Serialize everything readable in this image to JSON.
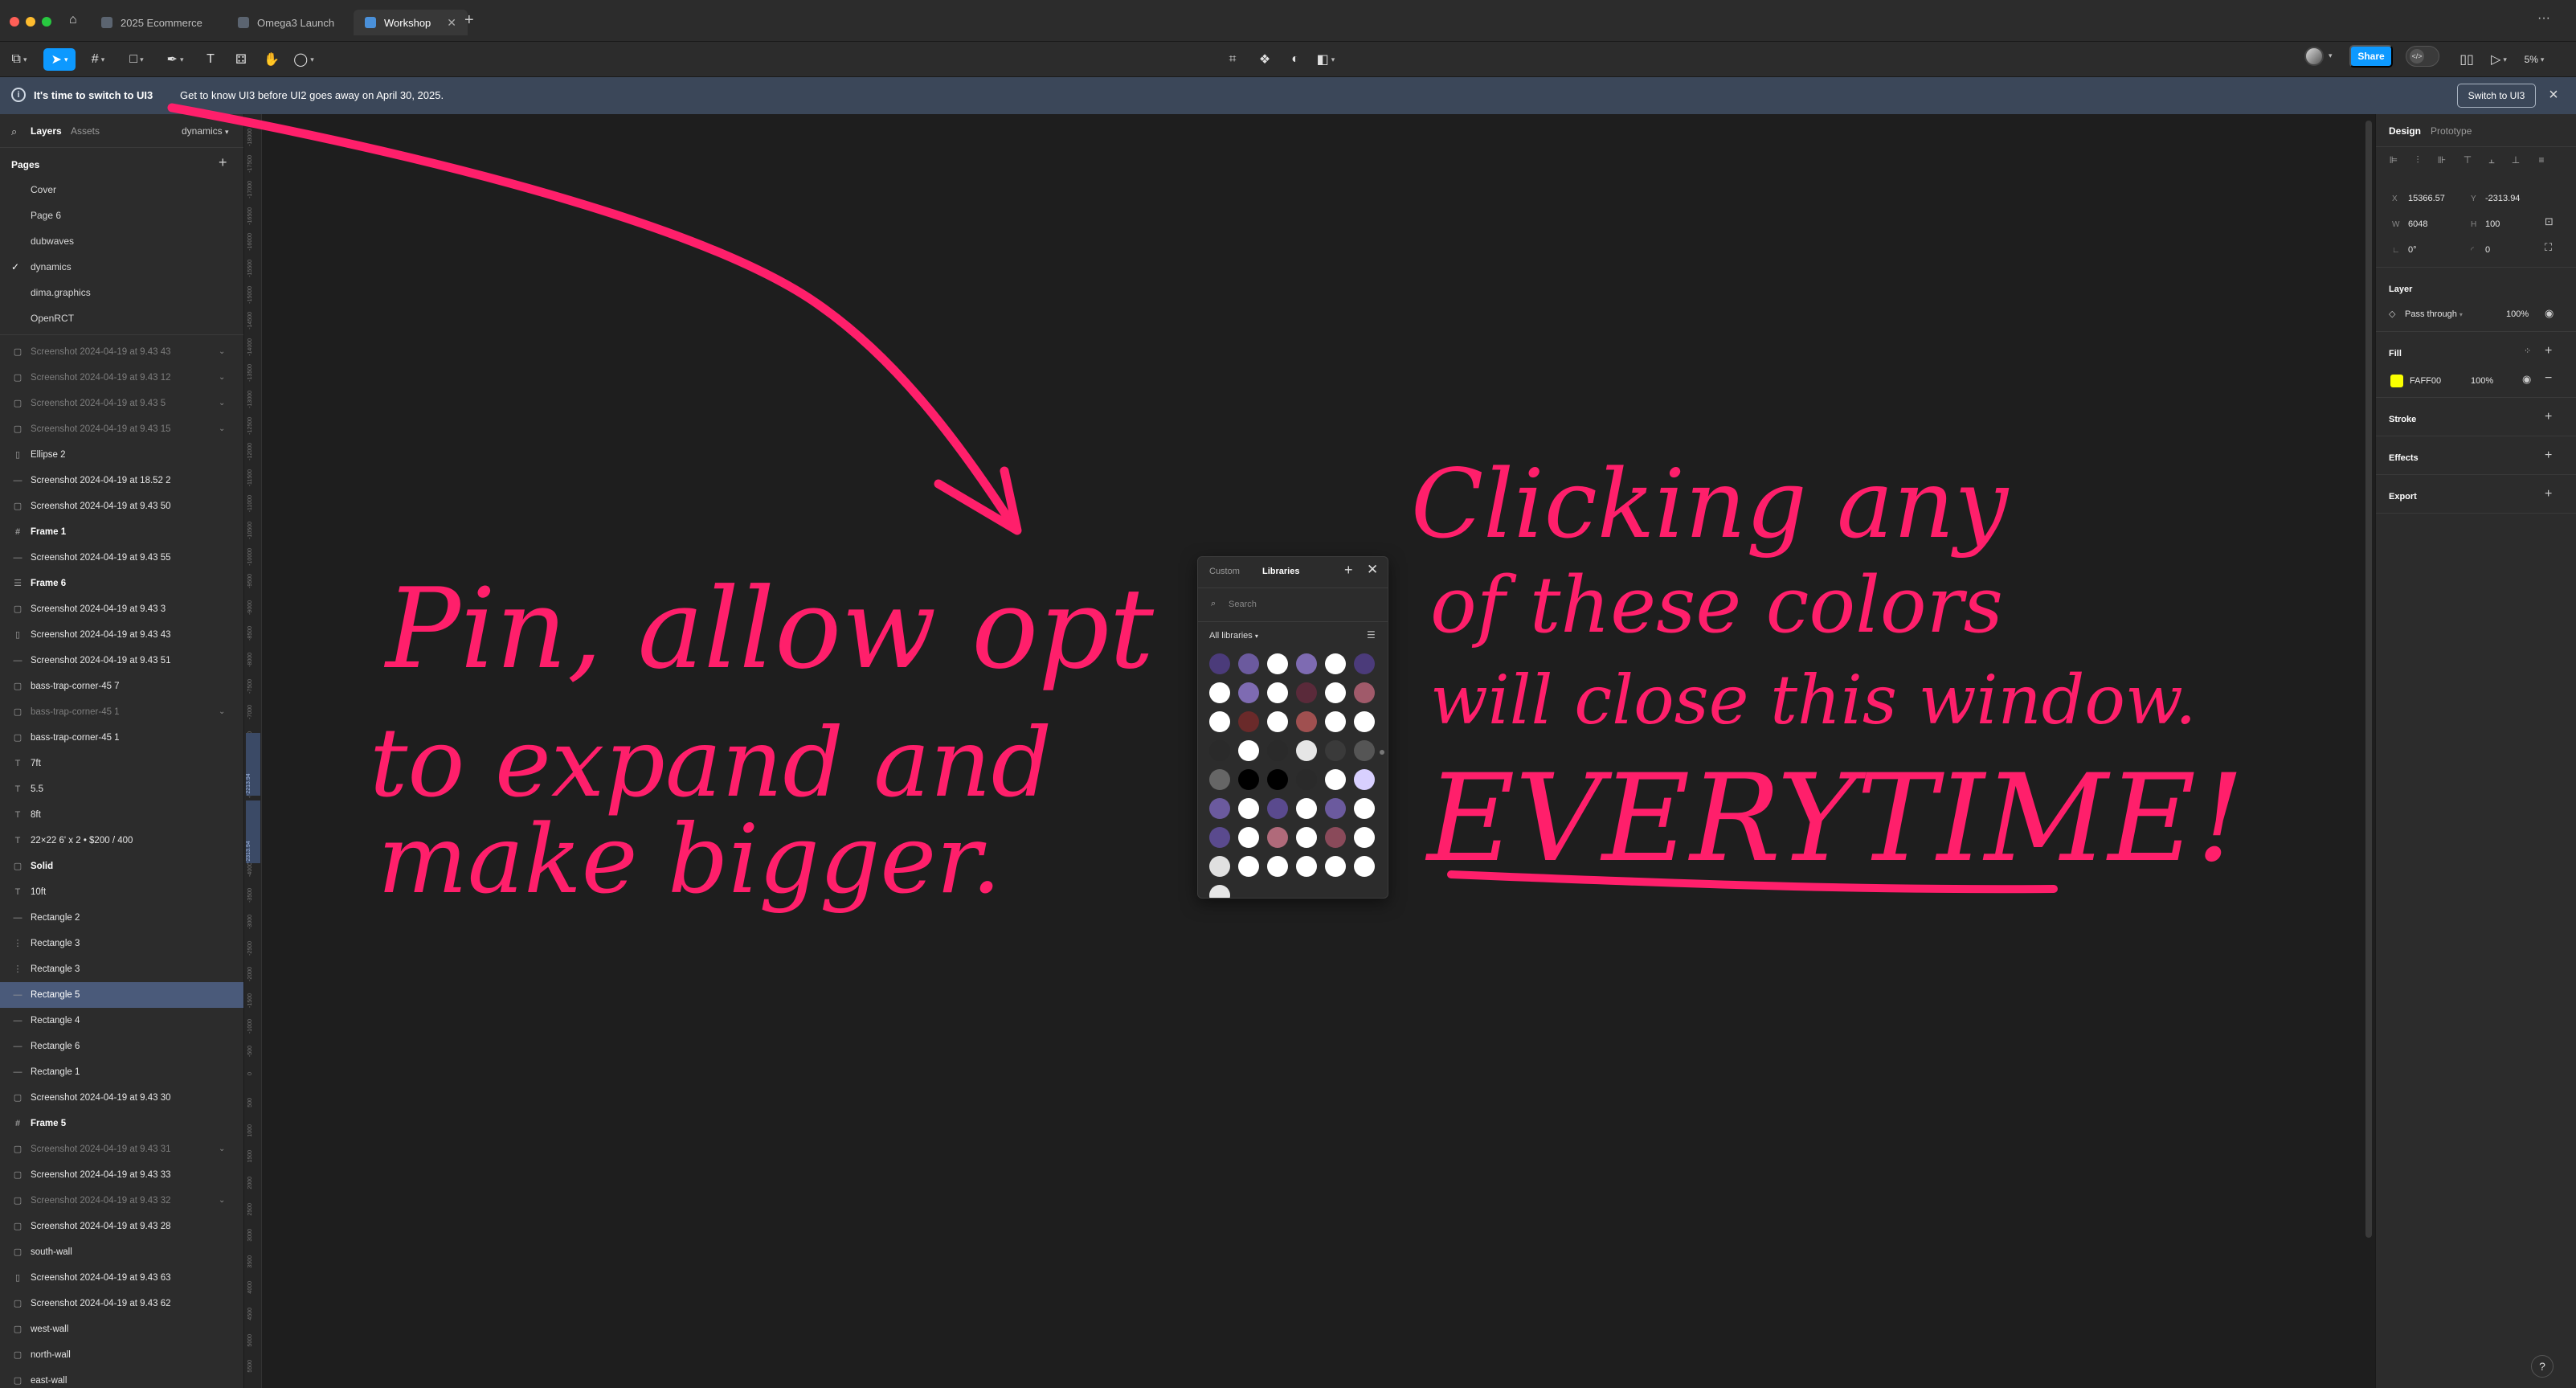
{
  "tabs": [
    {
      "label": "2025 Ecommerce",
      "active": false
    },
    {
      "label": "Omega3 Launch",
      "active": false
    },
    {
      "label": "Workshop",
      "active": true
    }
  ],
  "toolbar": {
    "share_label": "Share",
    "zoom": "5%"
  },
  "banner": {
    "title": "It's time to switch to UI3",
    "message": "Get to know UI3 before UI2 goes away on April 30, 2025.",
    "switch_label": "Switch to UI3"
  },
  "left_panel": {
    "tabs": [
      "Layers",
      "Assets"
    ],
    "current_page": "dynamics",
    "pages_heading": "Pages",
    "pages": [
      {
        "label": "Cover",
        "checked": false
      },
      {
        "label": "Page 6",
        "checked": false
      },
      {
        "label": "dubwaves",
        "checked": false
      },
      {
        "label": "dynamics",
        "checked": true
      },
      {
        "label": "dima.graphics",
        "checked": false
      },
      {
        "label": "OpenRCT",
        "checked": false
      }
    ],
    "layers": [
      {
        "label": "Screenshot 2024-04-19 at 9.43 43",
        "icon": "image",
        "dim": true,
        "chev": true
      },
      {
        "label": "Screenshot 2024-04-19 at 9.43 12",
        "icon": "image",
        "dim": true,
        "chev": true
      },
      {
        "label": "Screenshot 2024-04-19 at 9.43 5",
        "icon": "image",
        "dim": true,
        "chev": true
      },
      {
        "label": "Screenshot 2024-04-19 at 9.43 15",
        "icon": "image",
        "dim": true,
        "chev": true
      },
      {
        "label": "Ellipse 2",
        "icon": "rect",
        "dim": false
      },
      {
        "label": "Screenshot 2024-04-19 at 18.52 2",
        "icon": "line",
        "dim": false
      },
      {
        "label": "Screenshot 2024-04-19 at 9.43 50",
        "icon": "image",
        "dim": false
      },
      {
        "label": "Frame 1",
        "icon": "frame",
        "bold": true
      },
      {
        "label": "Screenshot 2024-04-19 at 9.43 55",
        "icon": "line",
        "dim": false
      },
      {
        "label": "Frame 6",
        "icon": "list",
        "bold": true
      },
      {
        "label": "Screenshot 2024-04-19 at 9.43 3",
        "icon": "image",
        "dim": false
      },
      {
        "label": "Screenshot 2024-04-19 at 9.43 43",
        "icon": "rect",
        "dim": false
      },
      {
        "label": "Screenshot 2024-04-19 at 9.43 51",
        "icon": "line",
        "dim": false
      },
      {
        "label": "bass-trap-corner-45 7",
        "icon": "image",
        "dim": false
      },
      {
        "label": "bass-trap-corner-45 1",
        "icon": "image",
        "dim": true,
        "chev": true
      },
      {
        "label": "bass-trap-corner-45 1",
        "icon": "image",
        "dim": false
      },
      {
        "label": "7ft",
        "icon": "text",
        "dim": false
      },
      {
        "label": "5.5",
        "icon": "text",
        "dim": false
      },
      {
        "label": "8ft",
        "icon": "text",
        "dim": false
      },
      {
        "label": "22×22 6' x 2 • $200 / 400",
        "icon": "text",
        "dim": false
      },
      {
        "label": "Solid",
        "icon": "image",
        "bold": true
      },
      {
        "label": "10ft",
        "icon": "text",
        "dim": false
      },
      {
        "label": "Rectangle 2",
        "icon": "line",
        "dim": false
      },
      {
        "label": "Rectangle 3",
        "icon": "vline",
        "dim": false
      },
      {
        "label": "Rectangle 3",
        "icon": "vline",
        "dim": false
      },
      {
        "label": "Rectangle 5",
        "icon": "line",
        "selected": true
      },
      {
        "label": "Rectangle 4",
        "icon": "line",
        "dim": false
      },
      {
        "label": "Rectangle 6",
        "icon": "line",
        "dim": false
      },
      {
        "label": "Rectangle 1",
        "icon": "line",
        "dim": false
      },
      {
        "label": "Screenshot 2024-04-19 at 9.43 30",
        "icon": "image",
        "dim": false
      },
      {
        "label": "Frame 5",
        "icon": "frame",
        "bold": true
      },
      {
        "label": "Screenshot 2024-04-19 at 9.43 31",
        "icon": "image",
        "dim": true,
        "chev": true
      },
      {
        "label": "Screenshot 2024-04-19 at 9.43 33",
        "icon": "image",
        "dim": false
      },
      {
        "label": "Screenshot 2024-04-19 at 9.43 32",
        "icon": "image",
        "dim": true,
        "chev": true
      },
      {
        "label": "Screenshot 2024-04-19 at 9.43 28",
        "icon": "image",
        "dim": false
      },
      {
        "label": "south-wall",
        "icon": "image",
        "dim": false
      },
      {
        "label": "Screenshot 2024-04-19 at 9.43 63",
        "icon": "rect",
        "dim": false
      },
      {
        "label": "Screenshot 2024-04-19 at 9.43 62",
        "icon": "image",
        "dim": false
      },
      {
        "label": "west-wall",
        "icon": "image",
        "dim": false
      },
      {
        "label": "north-wall",
        "icon": "image",
        "dim": false
      },
      {
        "label": "east-wall",
        "icon": "image",
        "dim": false
      }
    ]
  },
  "ruler_ticks": [
    "-18000",
    "-17500",
    "-17000",
    "-16500",
    "-16000",
    "-15500",
    "-15000",
    "-14500",
    "-14000",
    "-13500",
    "-13000",
    "-12500",
    "-12000",
    "-11500",
    "-11000",
    "-10500",
    "-10000",
    "-9500",
    "-9000",
    "-8500",
    "-8000",
    "-7500",
    "-7000",
    "-6500",
    "-6000",
    "-5500",
    "-5000",
    "-4500",
    "-4000",
    "-3500",
    "-3000",
    "-2500",
    "-2000",
    "-1500",
    "-1000",
    "-500",
    "0",
    "500",
    "1000",
    "1500",
    "2000",
    "2500",
    "3000",
    "3500",
    "4000",
    "4500",
    "5000",
    "5500"
  ],
  "ruler_marks": [
    "-2213.94",
    "-2313.94"
  ],
  "picker": {
    "tabs": [
      "Custom",
      "Libraries"
    ],
    "search_placeholder": "Search",
    "library_filter": "All libraries",
    "swatches": [
      "#4b3b7a",
      "#6b5a9e",
      "#ffffff",
      "#7e6bb2",
      "#ffffff",
      "#4b3b7a",
      "#ffffff",
      "#7e6bb2",
      "#ffffff",
      "#5a2a3a",
      "#ffffff",
      "#a05a6a",
      "#ffffff",
      "#6a2a2a",
      "#ffffff",
      "#a05050",
      "#ffffff",
      "#ffffff",
      "#2a2a2a",
      "#ffffff",
      "#2a2a2a",
      "#e6e6e6",
      "#3a3a3a",
      "#555555",
      "#666666",
      "#000000",
      "#000000",
      "#2a2a2a",
      "#ffffff",
      "#d8d0ff",
      "#6b5a9e",
      "#ffffff",
      "#5a4a8e",
      "#ffffff",
      "#6b5a9e",
      "#ffffff",
      "#5a4a8e",
      "#ffffff",
      "#b06a7a",
      "#ffffff",
      "#8a4a5a",
      "#ffffff",
      "#e0e0e0",
      "#ffffff",
      "#ffffff",
      "#ffffff",
      "#ffffff",
      "#ffffff",
      "#e6e6e6"
    ]
  },
  "right_panel": {
    "tabs": [
      "Design",
      "Prototype"
    ],
    "x_label": "X",
    "x_value": "15366.57",
    "y_label": "Y",
    "y_value": "-2313.94",
    "w_label": "W",
    "w_value": "6048",
    "h_label": "H",
    "h_value": "100",
    "rotation": "0°",
    "radius": "0",
    "layer_heading": "Layer",
    "blend_mode": "Pass through",
    "layer_opacity": "100%",
    "fill_heading": "Fill",
    "fill_hex": "FAFF00",
    "fill_color": "#faff00",
    "fill_opacity": "100%",
    "stroke_heading": "Stroke",
    "effects_heading": "Effects",
    "export_heading": "Export",
    "help": "?"
  },
  "annotations": {
    "note_left_1": "Pin, allow opt",
    "note_left_2": "to expand and",
    "note_left_3": "make bigger.",
    "note_right_1": "Clicking any",
    "note_right_2": "of these colors",
    "note_right_3": "will close this window.",
    "note_right_4": "EVERYTIME!"
  }
}
